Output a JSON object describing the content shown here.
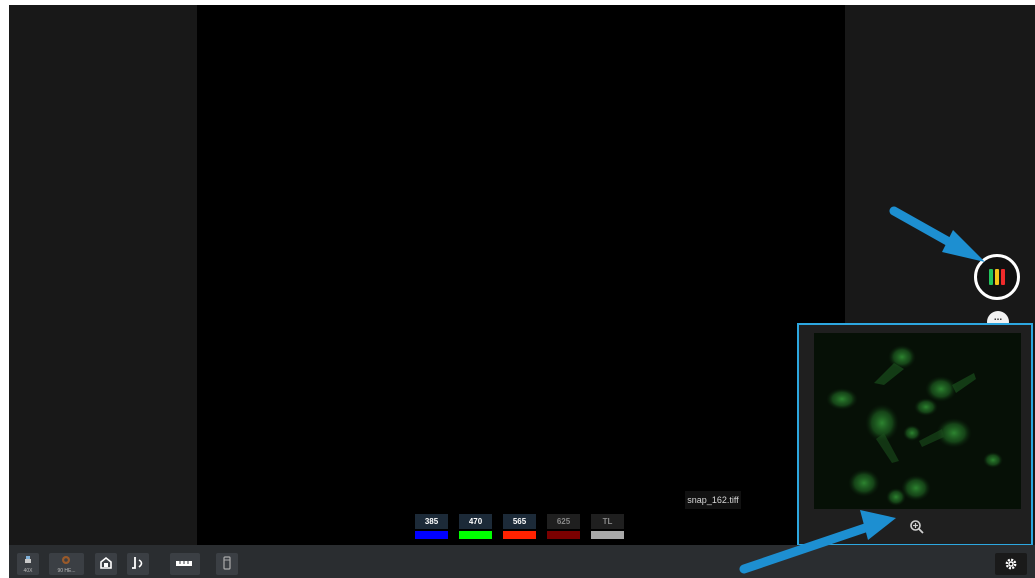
{
  "image": {
    "filename": "snap_162.tiff"
  },
  "channels": [
    {
      "label": "385",
      "color": "#0000ff",
      "active": true
    },
    {
      "label": "470",
      "color": "#00ff00",
      "active": true
    },
    {
      "label": "565",
      "color": "#ff2200",
      "active": true
    },
    {
      "label": "625",
      "color": "#7a0000",
      "active": false
    },
    {
      "label": "TL",
      "color": "#a8a8a8",
      "active": false
    }
  ],
  "lut_button": {
    "icon": "color-bars-icon",
    "colors": [
      "#22c55e",
      "#f5c518",
      "#ef2b2b"
    ]
  },
  "more_button": {
    "label": "..."
  },
  "toolbar": {
    "objective_label": "40X",
    "turret_label": "90 HE...",
    "items": [
      "objective-icon",
      "filter-turret-icon",
      "camera-settings-icon",
      "light-path-icon",
      "scale-bar-icon",
      "vessel-icon",
      "gear-icon"
    ]
  },
  "annotations": {
    "arrow_color": "#1d8fd1"
  }
}
